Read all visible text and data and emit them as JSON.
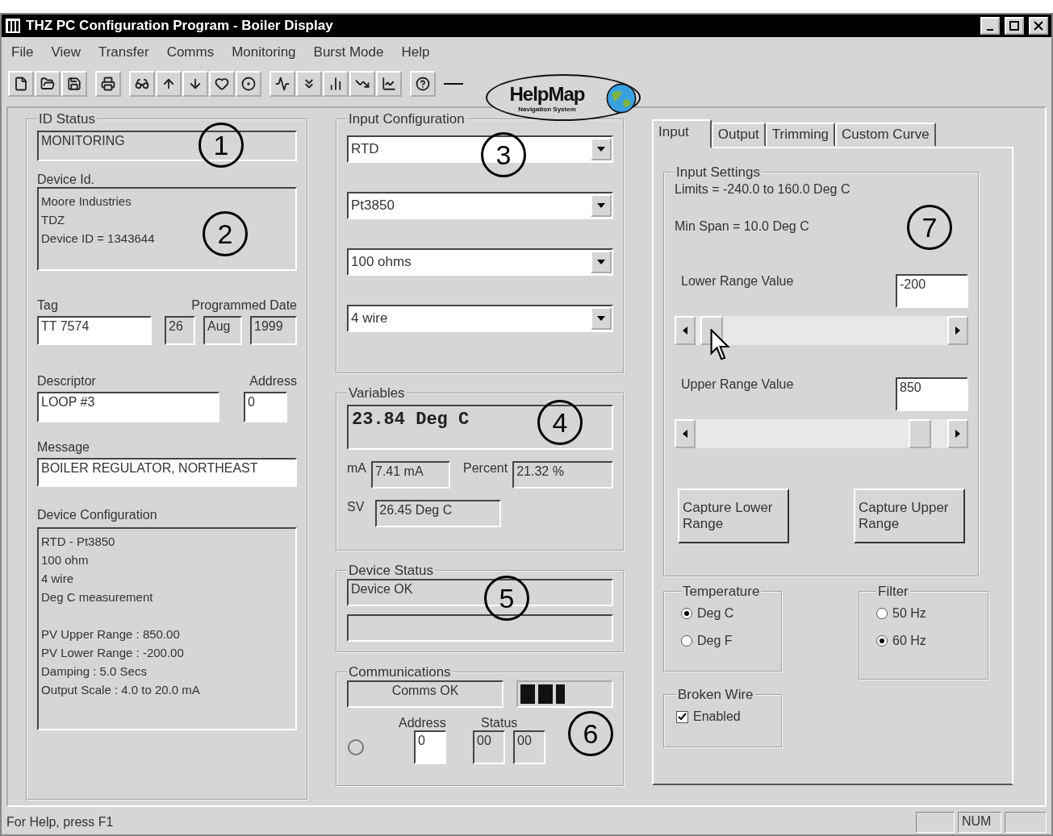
{
  "window": {
    "title": "THZ PC Configuration Program - Boiler Display"
  },
  "menu": [
    {
      "label": "File"
    },
    {
      "label": "View"
    },
    {
      "label": "Transfer"
    },
    {
      "label": "Comms"
    },
    {
      "label": "Monitoring"
    },
    {
      "label": "Burst Mode"
    },
    {
      "label": "Help"
    }
  ],
  "helpmap_logo": {
    "title": "HelpMap",
    "subtitle": "Navigation System"
  },
  "id_panel": {
    "title": "ID Status",
    "status": "MONITORING",
    "status_callout": "1",
    "device_id_label": "Device Id.",
    "device_id_lines": [
      "Moore Industries",
      "TDZ",
      "Device ID = 1343644"
    ],
    "device_id_callout": "2",
    "tag_label": "Tag",
    "tag": "TT 7574",
    "date_label": "Programmed Date",
    "date": [
      "26",
      "Aug",
      "1999"
    ],
    "descriptor_label": "Descriptor",
    "descriptor": "LOOP #3",
    "address_label": "Address",
    "address": "0",
    "message_label": "Message",
    "message": "BOILER REGULATOR, NORTHEAST",
    "config_label": "Device Configuration",
    "config_paragraphs": [
      [
        "RTD - Pt3850",
        "100 ohm",
        "4 wire",
        "Deg C measurement"
      ],
      [
        "PV Upper Range : 850.00",
        "PV Lower Range : -200.00",
        "Damping : 5.0 Secs",
        "Output Scale : 4.0 to 20.0 mA"
      ]
    ]
  },
  "input_configuration": {
    "title": "Input Configuration",
    "callout": "3",
    "dropdowns": [
      {
        "value": "RTD"
      },
      {
        "value": "Pt3850"
      },
      {
        "value": "100 ohms"
      },
      {
        "value": "4 wire"
      }
    ]
  },
  "variables": {
    "title": "Variables",
    "reading": "23.84 Deg C",
    "callout": "4",
    "ma_label": "mA",
    "ma": "7.41 mA",
    "percent_label": "Percent",
    "percent": "21.32 %",
    "sv_label": "SV",
    "sv": "26.45 Deg C"
  },
  "device_status": {
    "title": "Device Status",
    "status": "Device OK",
    "callout": "5"
  },
  "communications": {
    "title": "Communications",
    "status": "Comms OK",
    "level": 0.5,
    "address_label": "Address",
    "status_label": "Status",
    "address": "0",
    "status_codes": [
      "00",
      "00"
    ],
    "callout": "6"
  },
  "tabs": [
    {
      "label": "Input",
      "selected": true
    },
    {
      "label": "Output",
      "selected": false
    },
    {
      "label": "Trimming",
      "selected": false
    },
    {
      "label": "Custom Curve",
      "selected": false
    }
  ],
  "input_settings": {
    "title": "Input Settings",
    "limits": "Limits = -240.0 to 160.0 Deg C",
    "min_span": "Min Span = 10.0 Deg C",
    "callout": "7",
    "ranges": [
      {
        "label": "Lower Range Value",
        "value": "-200",
        "level": 0.02
      },
      {
        "label": "Upper Range Value",
        "value": "850",
        "level": 0.93
      }
    ],
    "buttons": [
      "Capture Lower Range",
      "Capture Upper Range"
    ]
  },
  "temperature": {
    "title": "Temperature",
    "options": [
      {
        "label": "Deg C",
        "selected": true
      },
      {
        "label": "Deg F",
        "selected": false
      }
    ]
  },
  "filter": {
    "title": "Filter",
    "options": [
      {
        "label": "50 Hz",
        "selected": false
      },
      {
        "label": "60 Hz",
        "selected": true
      }
    ]
  },
  "broken_wire": {
    "title": "Broken Wire",
    "label": "Enabled",
    "checked": true
  },
  "status_bar": {
    "help": "For Help, press F1",
    "num": "NUM"
  }
}
